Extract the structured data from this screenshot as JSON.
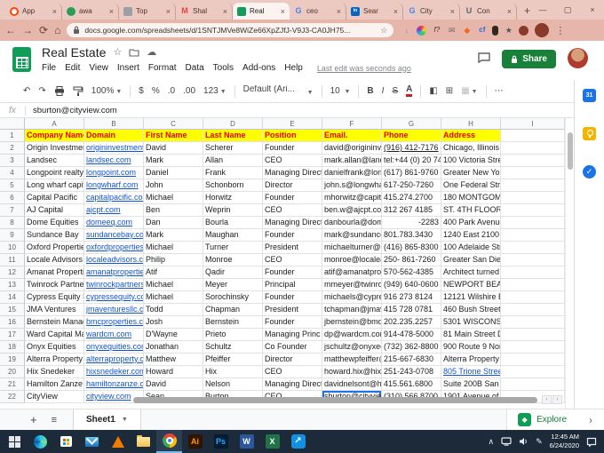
{
  "browser": {
    "tabs": [
      {
        "label": "App",
        "icon": "circle-red",
        "active": false
      },
      {
        "label": "awa",
        "icon": "circle-green",
        "active": false
      },
      {
        "label": "Top",
        "icon": "grid-gray",
        "active": false
      },
      {
        "label": "Shal",
        "icon": "gmail",
        "active": false
      },
      {
        "label": "Real",
        "icon": "sheets",
        "active": true
      },
      {
        "label": "ceo",
        "icon": "google",
        "active": false
      },
      {
        "label": "Sear",
        "icon": "linkedin",
        "active": false
      },
      {
        "label": "City",
        "icon": "google",
        "active": false
      },
      {
        "label": "Con",
        "icon": "u-gray",
        "active": false
      }
    ],
    "url": "docs.google.com/spreadsheets/d/1SNTJMVe8WiZe66XpZJfJ-V9J3-CA0JH75...",
    "extensions": [
      "download",
      "color-wheel",
      "fn",
      "mail",
      "diamond-orange",
      "cf",
      "mouse",
      "star",
      "dot-brown"
    ]
  },
  "header": {
    "title": "Real Estate",
    "menus": [
      "File",
      "Edit",
      "View",
      "Insert",
      "Format",
      "Data",
      "Tools",
      "Add-ons",
      "Help"
    ],
    "last_edit": "Last edit was seconds ago",
    "share_label": "Share"
  },
  "toolbar": {
    "zoom": "100%",
    "currency": "$",
    "percent": "%",
    "decrease_decimal": ".0",
    "increase_decimal": ".00",
    "more_formats": "123",
    "font": "Default (Ari...",
    "font_size": "10",
    "bold": "B",
    "italic": "I",
    "strikethrough": "S",
    "text_color": "A"
  },
  "formula_bar": {
    "fx": "fx",
    "value": "sburton@cityview.com"
  },
  "grid": {
    "columns": [
      "A",
      "B",
      "C",
      "D",
      "E",
      "F",
      "G",
      "H",
      "I"
    ],
    "header_row": [
      "Company Name",
      "Domain",
      "First Name",
      "Last Name",
      "Position",
      "Email.",
      "Phone",
      "Address"
    ],
    "rows": [
      [
        "Origin Investmen",
        "origininvestment",
        "David",
        "Scherer",
        "Founder",
        "david@origininve",
        "(916) 412-7176",
        "Chicago, Illinois"
      ],
      [
        "Landsec",
        "landsec.com",
        "Mark",
        "Allan",
        "CEO",
        "mark.allan@land",
        "tel:+44 (0) 20 74",
        "100 Victoria Stree"
      ],
      [
        "Longpoint realty",
        "longpoint.com",
        "Daniel",
        "Frank",
        "Managing Direct",
        "danielfrank@lon",
        "(617) 861-9760",
        "Greater New York"
      ],
      [
        "Long wharf capit",
        "longwharf.com",
        "John",
        "Schonborn",
        "Director",
        "john.s@longwha",
        "617-250-7260",
        "One Federal Stree"
      ],
      [
        "Capital Pacific",
        "capitalpacific.cor",
        "Michael",
        "Horwitz",
        "Founder",
        "mhorwitz@capita",
        "415.274.2700",
        "180 MONTGOME"
      ],
      [
        "AJ Capital",
        "ajcpt.com",
        "Ben",
        "Weprin",
        "CEO",
        "ben.w@ajcpt.cor",
        "312 267 4185",
        "ST. 4TH FLOOR"
      ],
      [
        "Dome Equities",
        "domeeq.com",
        "Dan",
        "Bourla",
        "Managing Direct",
        "danbourla@dom",
        "-2283",
        "400 Park Avenue"
      ],
      [
        "Sundance Bay",
        "sundancebay.cor",
        "Mark",
        "Maughan",
        "Founder",
        "mark@sundance",
        "801.783.3430",
        "1240 East 2100 S"
      ],
      [
        "Oxford Propertie",
        "oxfordproperties",
        "Michael",
        "Turner",
        "President",
        "michaelturner@c",
        "(416) 865-8300",
        "100 Adelaide Stre"
      ],
      [
        "Locale Advisors",
        "localeadvisors.cc",
        "Philip",
        "Monroe",
        "CEO",
        "monroe@localea",
        "250- 861-7260",
        "Greater San Dieg"
      ],
      [
        "Amanat Properti",
        "amanatpropertie",
        "Atif",
        "Qadir",
        "Founder",
        "atif@amanatprop",
        "570-562-4385",
        "Architect turned E"
      ],
      [
        "Twinrock Partner",
        "twinrockpartners",
        "Michael",
        "Meyer",
        "Principal",
        "mmeyer@twinro",
        "(949) 640-0600",
        "NEWPORT BEAC"
      ],
      [
        "Cypress Equity I",
        "cypressequity.co",
        "Michael",
        "Sorochinsky",
        "Founder",
        "michaels@cypre",
        "916 273 8124",
        "12121 Wilshire Bl"
      ],
      [
        "JMA Ventures",
        "jmaventuresllc.c",
        "Todd",
        "Chapman",
        "President",
        "tchapman@jmav",
        "415 728 0781",
        "460 Bush Street S"
      ],
      [
        "Bernstein Manag",
        "bmcproperties.c",
        "Josh",
        "Bernstein",
        "Founder",
        "jbernstein@bmq",
        "202.235.2257",
        "5301 WISCONSIN"
      ],
      [
        "Ward Capital Ma",
        "wardcm.com",
        "D'Wayne",
        "Prieto",
        "Managing Princ",
        "dp@wardcm.con",
        "914-478-5000",
        "81 Main Street Do"
      ],
      [
        "Onyx Equities",
        "onyxequities.con",
        "Jonathan",
        "Schultz",
        "Co Founder",
        "jschultz@onyxec",
        "(732) 362-8800",
        "900 Route 9 North"
      ],
      [
        "Alterra Property",
        "alterraproperty.c",
        "Matthew",
        "Pfeiffer",
        "Director",
        "matthewpfeiffer@",
        "215-667-6830",
        "Alterra Property Gr"
      ],
      [
        "Hix Snedeker",
        "hixsnedeker.com",
        "Howard",
        "Hix",
        "CEO",
        "howard.hix@hixs",
        "251-243-0708",
        "805 Trione Street"
      ],
      [
        "Hamilton Zanze",
        "hamiltonzanze.c",
        "David",
        "Nelson",
        "Managing Direct",
        "davidnelsont@ha",
        "415.561.6800",
        "Suite 200B San F"
      ],
      [
        "CityView",
        "cityview.com",
        "Sean",
        "Burton",
        "CEO",
        "sburton@cityview",
        "(310) 566 8700",
        "1901 Avenue of th"
      ]
    ],
    "selection": {
      "cell": "F22"
    }
  },
  "sheet_bar": {
    "sheet_name": "Sheet1",
    "explore_label": "Explore"
  },
  "side_panel": {
    "icons": [
      "calendar",
      "keep",
      "tasks"
    ],
    "calendar_label": "31"
  },
  "taskbar": {
    "apps": [
      "start",
      "edge",
      "store",
      "mailapp",
      "vlc",
      "explorer",
      "chrome",
      "illustrator",
      "photoshop",
      "word",
      "excel",
      "teamviewer"
    ],
    "active_app": "chrome",
    "time": "12:45 AM",
    "date": "6/24/2020"
  }
}
